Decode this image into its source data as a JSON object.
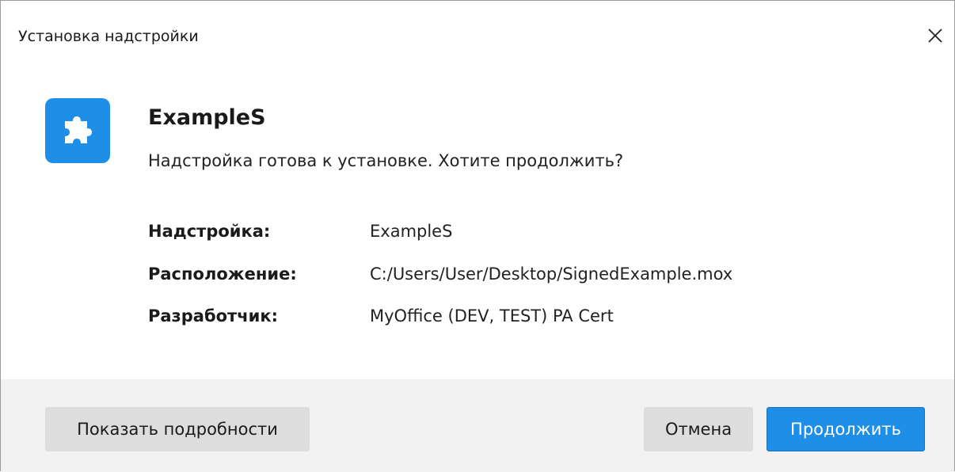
{
  "window": {
    "title": "Установка надстройки",
    "close_icon": "close-icon"
  },
  "addon": {
    "icon": "puzzle-icon",
    "icon_color": "#1e8ee6",
    "name": "ExampleS",
    "prompt": "Надстройка готова к установке. Хотите продолжить?"
  },
  "info": [
    {
      "label": "Надстройка:",
      "value": "ExampleS"
    },
    {
      "label": "Расположение:",
      "value": "C:/Users/User/Desktop/SignedExample.mox"
    },
    {
      "label": "Разработчик:",
      "value": "MyOffice (DEV, TEST) PA Cert"
    }
  ],
  "buttons": {
    "details": "Показать подробности",
    "cancel": "Отмена",
    "continue": "Продолжить",
    "accent_color": "#1e8ee6"
  }
}
